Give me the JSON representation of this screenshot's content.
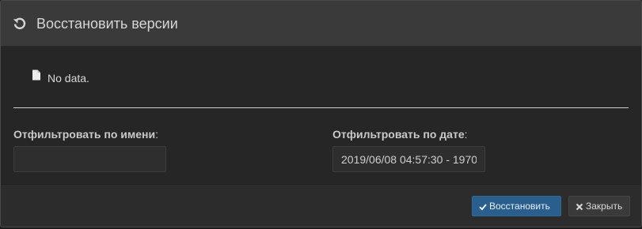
{
  "dialog": {
    "title": "Восстановить версии"
  },
  "body": {
    "empty_message": "No data.",
    "filter_name": {
      "label": "Отфильтровать по имени",
      "value": ""
    },
    "filter_date": {
      "label": "Отфильтровать по дате",
      "value": "2019/06/08 04:57:30 - 1970"
    }
  },
  "footer": {
    "restore_label": "Восстановить",
    "close_label": "Закрыть"
  },
  "icons": {
    "header": "restore-icon",
    "empty": "file-icon",
    "restore": "check-icon",
    "close": "close-icon"
  },
  "colors": {
    "primary": "#2a5f8d",
    "header_bg": "#3a3a3a",
    "body_bg": "#262626"
  }
}
